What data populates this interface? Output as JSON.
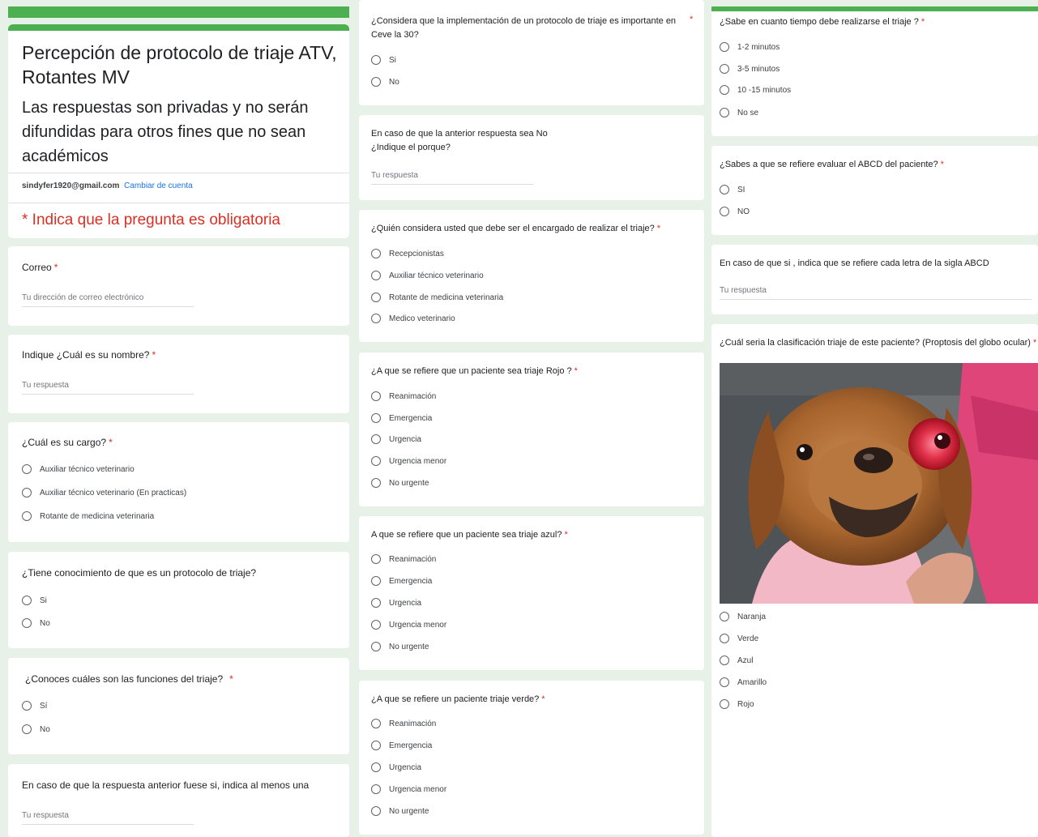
{
  "header": {
    "title": "Percepción  de protocolo de triaje ATV, Rotantes MV",
    "description": "Las respuestas son privadas y no serán difundidas para otros fines que no sean académicos",
    "email": "sindyfer1920@gmail.com",
    "switch_account": "Cambiar de cuenta",
    "required_note": "* Indica que la pregunta es obligatoria"
  },
  "colors": {
    "accent": "#4caf50",
    "required": "#d93025",
    "link": "#1a73e8"
  },
  "questions": {
    "correo": {
      "label": "Correo",
      "placeholder": "Tu dirección de correo electrónico"
    },
    "nombre": {
      "label": "Indique ¿Cuál es su nombre?",
      "placeholder": "Tu respuesta"
    },
    "cargo": {
      "label": "¿Cuál es su cargo?",
      "options": [
        "Auxiliar técnico veterinario",
        "Auxiliar técnico veterinario (En practicas)",
        "Rotante de medicina veterinaria"
      ]
    },
    "conocimiento": {
      "label": "¿Tiene conocimiento de que es un protocolo de triaje?",
      "options": [
        "Si",
        "No"
      ]
    },
    "funciones": {
      "label": "¿Conoces cuáles son las funciones del triaje?",
      "options": [
        "Sí",
        "No"
      ]
    },
    "indica_una": {
      "label": "En caso de que la respuesta anterior fuese si, indica al menos una",
      "placeholder": "Tu respuesta"
    },
    "importante": {
      "label": "¿Considera que la implementación de un protocolo de triaje es importante en Ceve la 30?",
      "options": [
        "Si",
        "No"
      ]
    },
    "porque": {
      "label1": "En caso de que la anterior respuesta sea No",
      "label2": "¿Indique el porque?",
      "placeholder": "Tu respuesta"
    },
    "encargado": {
      "label": "¿Quién considera usted que debe ser el encargado de realizar el triaje?",
      "options": [
        "Recepcionistas",
        "Auxiliar técnico veterinario",
        "Rotante de medicina veterinaria",
        "Medico veterinario"
      ]
    },
    "rojo": {
      "label": "¿A que se refiere que un paciente sea triaje Rojo ?",
      "options": [
        "Reanimación",
        "Emergencia",
        "Urgencia",
        "Urgencia menor",
        "No urgente"
      ]
    },
    "azul": {
      "label": "A que se refiere que un paciente sea triaje azul?",
      "options": [
        "Reanimación",
        "Emergencia",
        "Urgencia",
        "Urgencia menor",
        "No urgente"
      ]
    },
    "verde": {
      "label": "¿A que se refiere un paciente triaje verde?",
      "options": [
        "Reanimación",
        "Emergencia",
        "Urgencia",
        "Urgencia menor",
        "No urgente"
      ]
    },
    "tiempo": {
      "label": "¿Sabe en cuanto tiempo debe realizarse el triaje ?",
      "options": [
        "1-2 minutos",
        "3-5 minutos",
        "10 -15 minutos",
        "No se"
      ]
    },
    "abcd": {
      "label": "¿Sabes a que se refiere evaluar el ABCD del paciente?",
      "options": [
        "SI",
        "NO"
      ]
    },
    "abcd_letras": {
      "label": "En caso de que si , indica que se refiere cada letra de la sigla ABCD",
      "placeholder": "Tu respuesta"
    },
    "clasificacion": {
      "label": "¿Cuál seria la clasificación triaje de este paciente? (Proptosis del globo ocular)",
      "options": [
        "Naranja",
        "Verde",
        "Azul",
        "Amarillo",
        "Rojo"
      ]
    }
  }
}
